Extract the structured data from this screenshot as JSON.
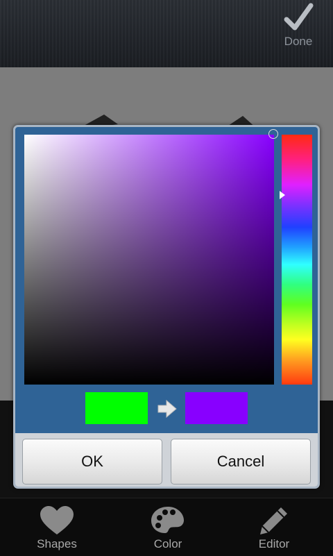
{
  "toolbar": {
    "done_label": "Done",
    "done_icon": "checkmark-icon"
  },
  "color_picker": {
    "current_hue_color": "#8800ff",
    "old_color": "#00ff00",
    "new_color": "#8800ff",
    "arrow_icon": "arrow-right-icon",
    "ok_label": "OK",
    "cancel_label": "Cancel"
  },
  "bottom_nav": {
    "items": [
      {
        "label": "Shapes",
        "icon": "heart-icon"
      },
      {
        "label": "Color",
        "icon": "palette-icon"
      },
      {
        "label": "Editor",
        "icon": "pencil-icon"
      }
    ]
  }
}
